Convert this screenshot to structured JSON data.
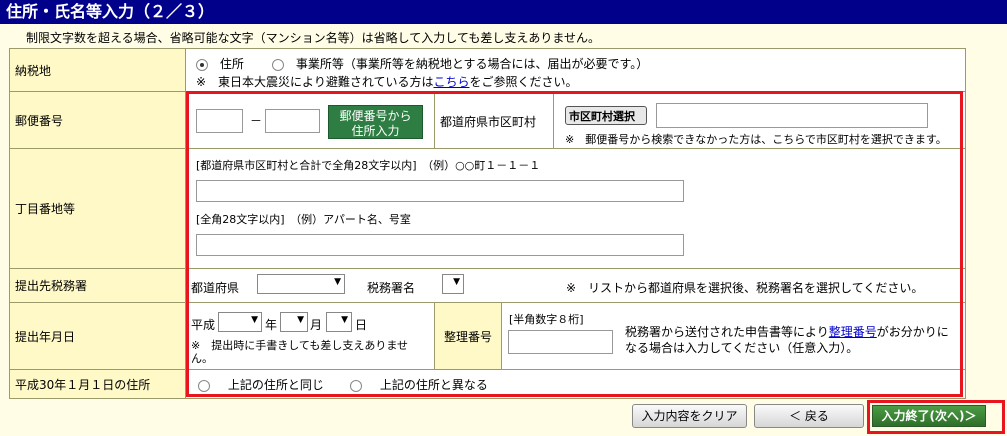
{
  "header": {
    "title": "住所・氏名等入力（２／３）"
  },
  "note": "制限文字数を超える場合、省略可能な文字（マンション名等）は省略して入力しても差し支えありません。",
  "tax_place": {
    "label": "納税地",
    "option_address": "住所",
    "option_office": "事業所等（事業所等を納税地とする場合には、届出が必要です。）",
    "evac_prefix": "※　東日本大震災により避難されている方は",
    "evac_link": "こちら",
    "evac_suffix": "をご参照ください。"
  },
  "postal": {
    "label": "郵便番号",
    "dash": "－",
    "search_button": "郵便番号から\n住所入力",
    "pref_label": "都道府県市区町村",
    "city_select_button": "市区町村選択",
    "city_note": "※　郵便番号から検索できなかった方は、こちらで市区町村を選択できます。"
  },
  "street": {
    "label": "丁目番地等",
    "hint1": "[都道府県市区町村と合計で全角28文字以内]　（例）○○町１－１－１",
    "hint2": "[全角28文字以内]　（例）アパート名、号室"
  },
  "tax_office": {
    "label": "提出先税務署",
    "pref_label": "都道府県",
    "office_label": "税務署名",
    "note": "※　リストから都道府県を選択後、税務署名を選択してください。"
  },
  "submit_date": {
    "label": "提出年月日",
    "era": "平成",
    "year": "年",
    "month": "月",
    "day": "日",
    "note": "※　提出時に手書きしても差し支えありません。",
    "ref_label": "整理番号",
    "ref_hint": "[半角数字８桁]",
    "ref_note_prefix": "税務署から送付された申告書等により",
    "ref_link": "整理番号",
    "ref_note_suffix": "がお分かりになる場合は入力してください（任意入力）。"
  },
  "jan1_address": {
    "label": "平成30年１月１日の住所",
    "option_same": "上記の住所と同じ",
    "option_diff": "上記の住所と異なる"
  },
  "footer": {
    "clear_button": "入力内容をクリア",
    "back_button": "＜ 戻る",
    "next_button": "入力終了(次へ)＞"
  },
  "colors": {
    "header_bg": "#00008b",
    "label_bg": "#fff9c8",
    "highlight": "#e8141e",
    "green_button": "#2e7d43"
  }
}
